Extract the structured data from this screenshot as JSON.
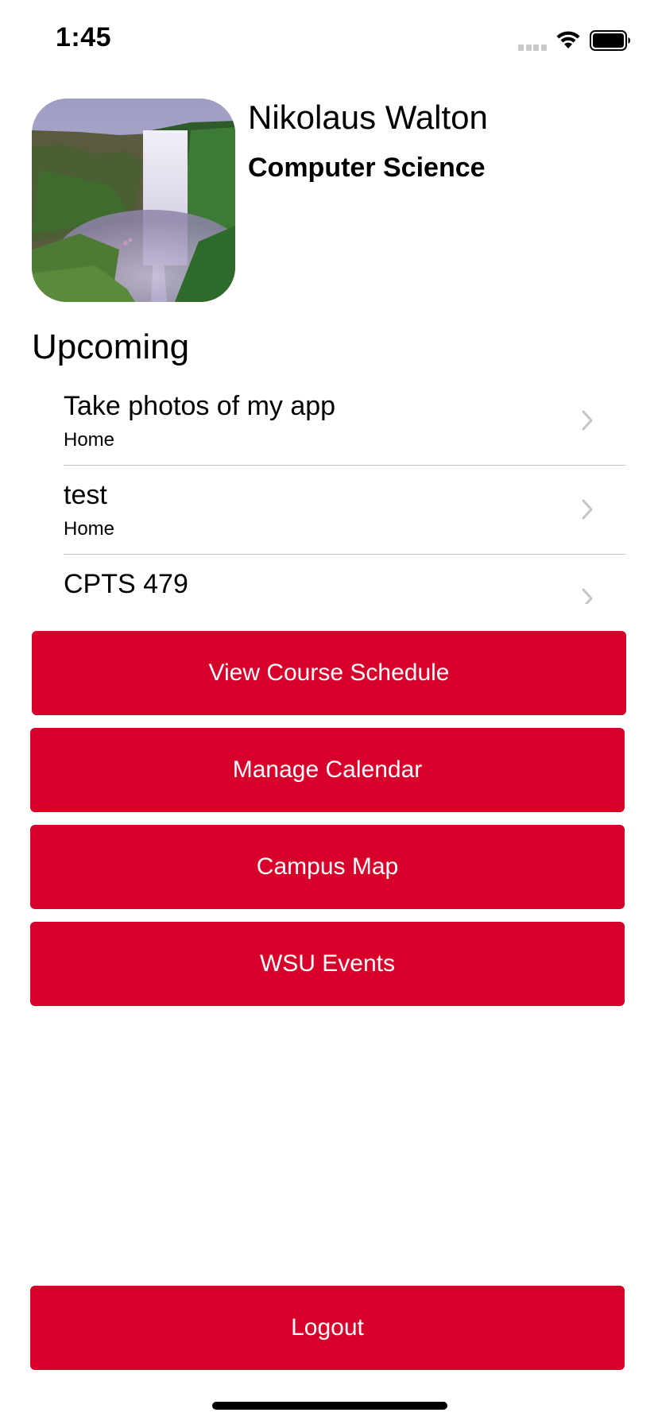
{
  "status_bar": {
    "time": "1:45",
    "icons": [
      "cellular-signal-icon",
      "wifi-icon",
      "battery-icon"
    ]
  },
  "profile": {
    "name": "Nikolaus Walton",
    "major": "Computer Science",
    "avatar_icon": "waterfall-photo"
  },
  "upcoming": {
    "title": "Upcoming",
    "items": [
      {
        "title": "Take photos of my app",
        "subtitle": "Home"
      },
      {
        "title": "test",
        "subtitle": "Home"
      },
      {
        "title": "CPTS 479",
        "subtitle": ""
      }
    ]
  },
  "actions": {
    "view_course_schedule": "View Course Schedule",
    "manage_calendar": "Manage Calendar",
    "campus_map": "Campus Map",
    "wsu_events": "WSU Events",
    "logout": "Logout"
  },
  "colors": {
    "accent": "#d6002b",
    "separator": "#c8c7cc",
    "chevron": "#c4c4c7"
  }
}
